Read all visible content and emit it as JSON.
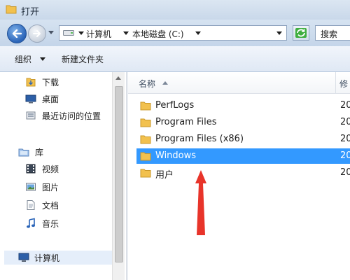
{
  "window": {
    "title": "打开"
  },
  "address_bar": {
    "breadcrumbs": [
      "计算机",
      "本地磁盘 (C:)"
    ]
  },
  "search": {
    "placeholder": "搜索"
  },
  "toolbar": {
    "organize_label": "组织",
    "new_folder_label": "新建文件夹"
  },
  "sidebar": {
    "favorites": [
      {
        "label": "下载",
        "icon": "downloads-folder-icon"
      },
      {
        "label": "桌面",
        "icon": "desktop-icon"
      },
      {
        "label": "最近访问的位置",
        "icon": "recent-places-icon"
      }
    ],
    "libraries": {
      "label": "库",
      "icon": "libraries-icon",
      "items": [
        {
          "label": "视频",
          "icon": "videos-icon"
        },
        {
          "label": "图片",
          "icon": "pictures-icon"
        },
        {
          "label": "文档",
          "icon": "documents-icon"
        },
        {
          "label": "音乐",
          "icon": "music-icon"
        }
      ]
    },
    "computer": {
      "label": "计算机",
      "icon": "computer-icon"
    }
  },
  "file_list": {
    "columns": {
      "name": "名称",
      "date": "修"
    },
    "rows": [
      {
        "name": "PerfLogs",
        "date": "20",
        "selected": false
      },
      {
        "name": "Program Files",
        "date": "20",
        "selected": false
      },
      {
        "name": "Program Files (x86)",
        "date": "20",
        "selected": false
      },
      {
        "name": "Windows",
        "date": "20",
        "selected": true
      },
      {
        "name": "用户",
        "date": "20",
        "selected": false
      }
    ]
  },
  "colors": {
    "selection": "#3399ff",
    "annotation_arrow": "#e8342a",
    "folder": "#f2c14e"
  }
}
